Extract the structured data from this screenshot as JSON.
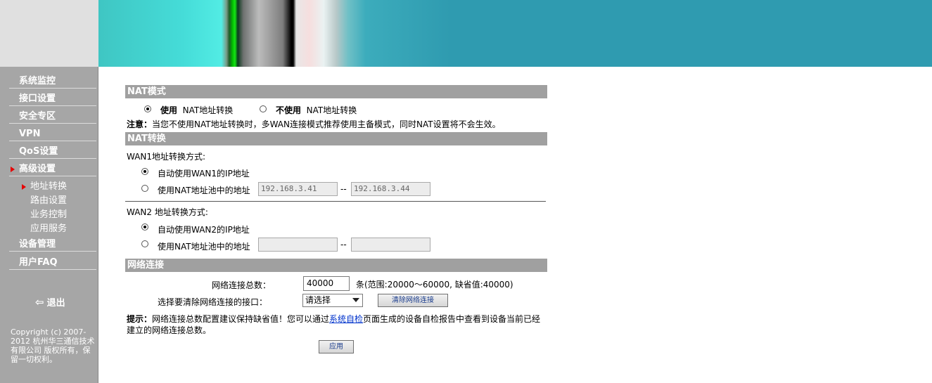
{
  "sidebar": {
    "nav": [
      "系统监控",
      "接口设置",
      "安全专区",
      "VPN",
      "QoS设置",
      "高级设置"
    ],
    "sub": [
      "地址转换",
      "路由设置",
      "业务控制",
      "应用服务"
    ],
    "nav2": [
      "设备管理",
      "用户FAQ"
    ],
    "logout": "退出",
    "copyright": "Copyright (c) 2007-2012  杭州华三通信技术有限公司 版权所有，保留一切权利。"
  },
  "nat_mode": {
    "title": "NAT模式",
    "use_bold": "使用",
    "use_text": "NAT地址转换",
    "nouse_bold": "不使用",
    "nouse_text": "NAT地址转换",
    "note_bold": "注意：",
    "note_text": "当您不使用NAT地址转换时，多WAN连接模式推荐使用主备模式，同时NAT设置将不会生效。",
    "selected": "use"
  },
  "nat_convert": {
    "title": "NAT转换",
    "wan1_label": "WAN1地址转换方式:",
    "wan1_auto": "自动使用WAN1的IP地址",
    "wan1_pool": "使用NAT地址池中的地址",
    "wan1_start": "192.168.3.41",
    "wan1_end": "192.168.3.44",
    "wan2_label": "WAN2 地址转换方式:",
    "wan2_auto": "自动使用WAN2的IP地址",
    "wan2_pool": "使用NAT地址池中的地址",
    "wan2_start": "",
    "wan2_end": "",
    "dash": "--"
  },
  "network": {
    "title": "网络连接",
    "total_label": "网络连接总数：",
    "total_value": "40000",
    "range_text": "条(范围:20000～60000, 缺省值:40000)",
    "clear_label": "选择要清除网络连接的接口：",
    "select_value": "请选择",
    "clear_button": "清除网络连接",
    "tip_bold": "提示：",
    "tip_pre": "网络连接总数配置建议保持缺省值！您可以通过",
    "tip_link": "系统自检",
    "tip_post": "页面生成的设备自检报告中查看到设备当前已经建立的网络连接总数。",
    "apply_button": "应用"
  }
}
